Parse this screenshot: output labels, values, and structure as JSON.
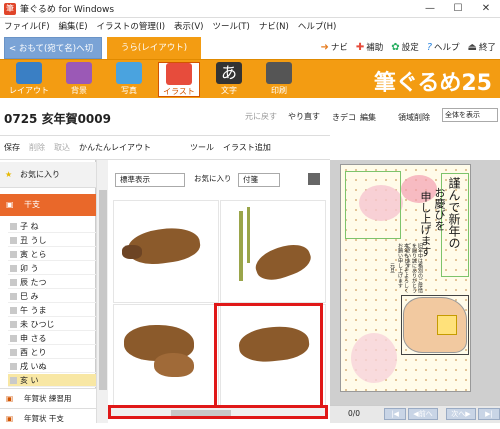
{
  "window": {
    "title": "筆ぐるめ for Windows",
    "controls": [
      "—",
      "☐",
      "✕"
    ]
  },
  "menu": [
    "ファイル(F)",
    "編集(E)",
    "イラストの管理(I)",
    "表示(V)",
    "ツール(T)",
    "ナビ(N)",
    "ヘルプ(H)"
  ],
  "modes": {
    "address": "おもて(宛て名)へ切替",
    "layout": "うら(レイアウト)"
  },
  "quicklinks": [
    {
      "icon": "navi-icon",
      "label": "ナビ"
    },
    {
      "icon": "assist-icon",
      "label": "補助"
    },
    {
      "icon": "settings-icon",
      "label": "設定"
    },
    {
      "icon": "help-icon",
      "label": "ヘルプ"
    },
    {
      "icon": "exit-icon",
      "label": "終了"
    }
  ],
  "ribbon": [
    {
      "label": "レイアウト",
      "icon": "layout-icon",
      "color": "#3a7fc4"
    },
    {
      "label": "背景",
      "icon": "background-icon",
      "color": "#9b59b6"
    },
    {
      "label": "写真",
      "icon": "photo-icon",
      "color": "#4aa3df"
    },
    {
      "label": "イラスト",
      "icon": "illust-icon",
      "color": "#e74c3c"
    },
    {
      "label": "文字",
      "icon": "text-icon",
      "color": "#333333"
    },
    {
      "label": "印刷",
      "icon": "print-icon",
      "color": "#555555"
    }
  ],
  "brand": "筆ぐるめ25",
  "document": {
    "title": "0725 亥年賀0009",
    "undo": "元に戻す",
    "redo": "やり直す"
  },
  "toolbar2": [
    "保存",
    "削除",
    "取込",
    "かんたんレイアウト",
    "ツール",
    "イラスト追加"
  ],
  "right_toolbar": {
    "items": [
      "きデコ",
      "編集",
      "領域削除"
    ],
    "zoom": "全体を表示"
  },
  "sidebar": {
    "favorite": "お気に入り",
    "category": "干支",
    "items": [
      "子 ね",
      "丑 うし",
      "寅 とら",
      "卯 う",
      "辰 たつ",
      "巳 み",
      "午 うま",
      "未 ひつじ",
      "申 さる",
      "酉 とり",
      "戌 いぬ",
      "亥 い"
    ],
    "selected_item": "亥 い",
    "more": [
      "年賀状 練習用",
      "年賀状 干支"
    ]
  },
  "gallery": {
    "filter_view": "標準表示",
    "filter_fav": "お気に入り",
    "filter_sort": "付箋"
  },
  "card": {
    "greeting": "謹んで新年の",
    "greeting2": "お慶びを",
    "greeting3": "申し上げます",
    "note": "旧年中は格別のご厚情を賜り誠にありがとうございます",
    "note2": "本年もどうぞよろしくお願い申し上げます",
    "date": "元旦"
  },
  "pager": {
    "count": "0/0",
    "prev": "前へ",
    "next": "次へ"
  }
}
